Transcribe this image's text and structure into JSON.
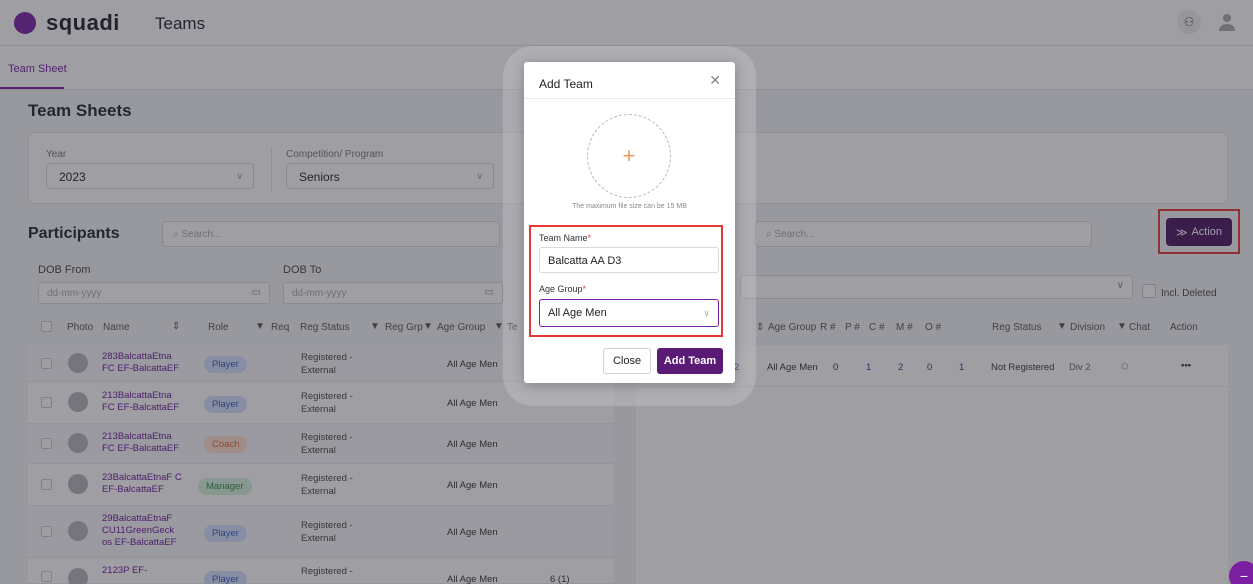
{
  "header": {
    "brand": "squadi",
    "module": "Teams"
  },
  "tabs": [
    {
      "label": "Team Sheet"
    }
  ],
  "page_title": "Team Sheets",
  "filters": {
    "year_label": "Year",
    "year_value": "2023",
    "competition_label": "Competition/ Program",
    "competition_value": "Seniors"
  },
  "participants": {
    "title": "Participants",
    "search_placeholder": "Search...",
    "dob_from_label": "DOB From",
    "dob_to_label": "DOB To",
    "date_placeholder": "dd-mm-yyyy",
    "columns": [
      "Photo",
      "Name",
      "Role",
      "Req",
      "Reg Status",
      "Reg Grp",
      "Age Group",
      "Te"
    ],
    "rows": [
      {
        "name": "283BalcattaEtna FC EF-BalcattaEF",
        "role": "Player",
        "status": "Registered - External",
        "age": "All Age Men",
        "team": ""
      },
      {
        "name": "213BalcattaEtna FC EF-BalcattaEF",
        "role": "Player",
        "status": "Registered - External",
        "age": "All Age Men",
        "team": ""
      },
      {
        "name": "213BalcattaEtna FC EF-BalcattaEF",
        "role": "Coach",
        "status": "Registered - External",
        "age": "All Age Men",
        "team": ""
      },
      {
        "name": "23BalcattaEtnaF C EF-BalcattaEF",
        "role": "Manager",
        "status": "Registered - External",
        "age": "All Age Men",
        "team": ""
      },
      {
        "name": "29BalcattaEtnaF CU11GreenGeck os EF-BalcattaEF",
        "role": "Player",
        "status": "Registered - External",
        "age": "All Age Men",
        "team": ""
      },
      {
        "name": "2123P EF-",
        "role": "Player",
        "status": "Registered -",
        "age": "All Age Men",
        "team": "6 (1)"
      }
    ]
  },
  "teams": {
    "search_placeholder": "Search...",
    "action_label": "Action",
    "incl_deleted_label": "Incl. Deleted",
    "columns": [
      "Age Group",
      "R #",
      "P #",
      "C #",
      "M #",
      "O #",
      "Reg Status",
      "Division",
      "Chat",
      "Action"
    ],
    "row": {
      "lead": "2",
      "age": "All Age Men",
      "r": "0",
      "p": "1",
      "c": "2",
      "m": "0",
      "o": "1",
      "status": "Not Registered",
      "division": "Div 2",
      "more": "•••"
    }
  },
  "modal": {
    "title": "Add Team",
    "hint": "The maximum file size can be 15 MB",
    "team_name_label": "Team Name",
    "team_name_value": "Balcatta AA D3",
    "age_group_label": "Age Group",
    "age_group_value": "All Age Men",
    "required_mark": "*",
    "close_label": "Close",
    "add_label": "Add Team"
  },
  "colors": {
    "brand": "#7b1fa2",
    "primary_button": "#5a1a75",
    "highlight": "#e53935"
  }
}
